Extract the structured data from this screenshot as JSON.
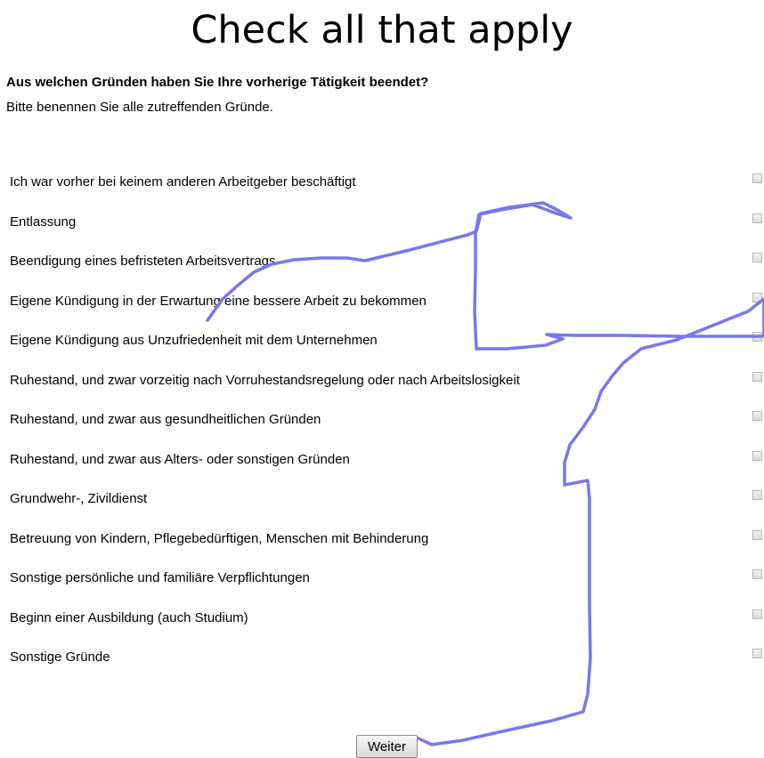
{
  "slide_title": "Check all that apply",
  "question": {
    "text": "Aus welchen Gründen haben Sie Ihre vorherige Tätigkeit beendet?",
    "instruction": "Bitte benennen Sie alle zutreffenden Gründe."
  },
  "options": [
    {
      "label": "Ich war vorher bei keinem anderen Arbeitgeber beschäftigt",
      "checked": false
    },
    {
      "label": "Entlassung",
      "checked": false
    },
    {
      "label": "Beendigung eines befristeten Arbeitsvertrags",
      "checked": false
    },
    {
      "label": "Eigene Kündigung in der Erwartung eine bessere Arbeit zu bekommen",
      "checked": false
    },
    {
      "label": "Eigene Kündigung aus Unzufriedenheit mit dem Unternehmen",
      "checked": false
    },
    {
      "label": "Ruhestand, und zwar vorzeitig nach Vorruhestandsregelung oder nach Arbeitslosigkeit",
      "checked": false
    },
    {
      "label": "Ruhestand, und zwar aus gesundheitlichen Gründen",
      "checked": false
    },
    {
      "label": "Ruhestand, und zwar aus Alters- oder sonstigen Gründen",
      "checked": false
    },
    {
      "label": "Grundwehr-, Zivildienst",
      "checked": false
    },
    {
      "label": "Betreuung von Kindern, Pflegebedürftigen, Menschen mit Behinderung",
      "checked": false
    },
    {
      "label": "Sonstige persönliche und familiäre Verpflichtungen",
      "checked": false
    },
    {
      "label": "Beginn einer Ausbildung (auch Studium)",
      "checked": false
    },
    {
      "label": "Sonstige Gründe",
      "checked": false
    }
  ],
  "next_button": {
    "label": "Weiter"
  },
  "colors": {
    "mouse_trace": "#7777ee",
    "checkbox_border": "#b8b8b8"
  }
}
